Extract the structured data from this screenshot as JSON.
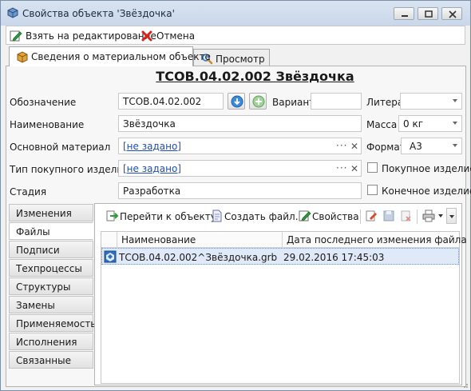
{
  "window": {
    "title": "Свойства объекта 'Звёздочка'"
  },
  "toolbar": {
    "edit_label": "Взять на редактирование",
    "cancel_label": "Отмена"
  },
  "tabs": [
    {
      "label": "Сведения о материальном объекте",
      "icon": "box-icon",
      "active": true
    },
    {
      "label": "Просмотр",
      "icon": "magnifier-icon",
      "active": false
    }
  ],
  "object": {
    "heading": "ТСОВ.04.02.002 Звёздочка"
  },
  "fields": {
    "designation_label": "Обозначение",
    "designation_value": "ТСОВ.04.02.002",
    "variant_label": "Вариант",
    "variant_value": "",
    "litera_label": "Литера",
    "litera_value": "",
    "name_label": "Наименование",
    "name_value": "Звёздочка",
    "mass_label": "Масса",
    "mass_value": "0 кг",
    "material_label": "Основной материал",
    "material_value": "[не задано]",
    "format_label": "Формат",
    "format_value": "А3",
    "purchased_type_label": "Тип покупного изделия",
    "purchased_type_value": "[не задано]",
    "purchased_checkbox_label": "Покупное изделие",
    "purchased_checked": false,
    "stage_label": "Стадия",
    "stage_value": "Разработка",
    "final_checkbox_label": "Конечное изделие",
    "final_checked": false,
    "ellipsis": "···",
    "clear": "✕"
  },
  "side_tabs": [
    {
      "label": "Изменения",
      "selected": false
    },
    {
      "label": "Файлы",
      "selected": true
    },
    {
      "label": "Подписи",
      "selected": false
    },
    {
      "label": "Техпроцессы",
      "selected": false
    },
    {
      "label": "Структуры",
      "selected": false
    },
    {
      "label": "Замены",
      "selected": false
    },
    {
      "label": "Применяемость",
      "selected": false
    },
    {
      "label": "Исполнения",
      "selected": false
    },
    {
      "label": "Связанные",
      "selected": false
    }
  ],
  "files_toolbar": {
    "goto_label": "Перейти к объекту",
    "create_label": "Создать файл...",
    "properties_label": "Свойства"
  },
  "files_table": {
    "columns": [
      "Наименование",
      "Дата последнего изменения файла"
    ],
    "rows": [
      {
        "name": "ТСОВ.04.02.002^Звёздочка.grb",
        "date": "29.02.2016 17:45:03"
      }
    ]
  },
  "colors": {
    "titlebar": "#d2ddec",
    "link": "#1e4fb3",
    "selection": "#dfe9f8"
  }
}
